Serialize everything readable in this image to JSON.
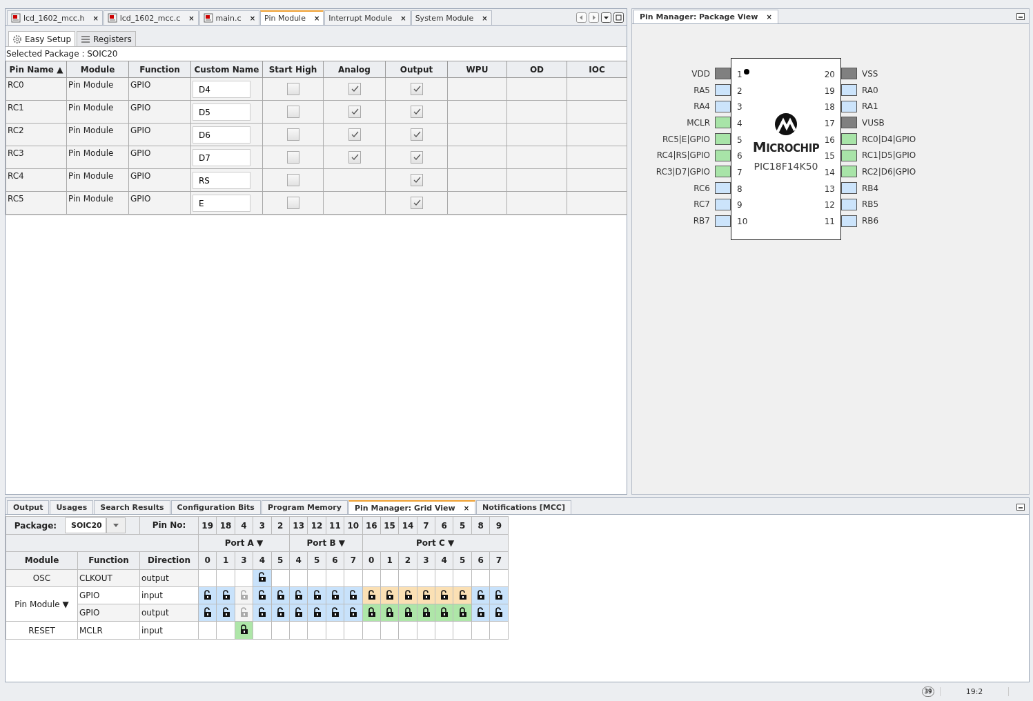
{
  "editor_tabs": [
    {
      "label": "lcd_1602_mcc.h",
      "kind": "file",
      "selected": false,
      "close": "×"
    },
    {
      "label": "lcd_1602_mcc.c",
      "kind": "file",
      "selected": false,
      "close": "×"
    },
    {
      "label": "main.c",
      "kind": "file",
      "selected": false,
      "close": "×"
    },
    {
      "label": "Pin Module",
      "kind": "plain",
      "selected": true,
      "close": "×"
    },
    {
      "label": "Interrupt Module",
      "kind": "plain",
      "selected": false,
      "close": "×"
    },
    {
      "label": "System Module",
      "kind": "plain",
      "selected": false,
      "close": "×"
    }
  ],
  "sub_tabs": [
    {
      "label": "Easy Setup",
      "kind": "gear",
      "selected": true
    },
    {
      "label": "Registers",
      "kind": "list",
      "selected": false
    }
  ],
  "selected_package": "Selected Package : SOIC20",
  "pin_table": {
    "columns": [
      "Pin Name ▲",
      "Module",
      "Function",
      "Custom Name",
      "Start High",
      "Analog",
      "Output",
      "WPU",
      "OD",
      "IOC"
    ],
    "rows": [
      {
        "pin": "RC0",
        "module": "Pin Module",
        "function": "GPIO",
        "custom_name": "D4",
        "start_high": false,
        "analog": true,
        "output": true
      },
      {
        "pin": "RC1",
        "module": "Pin Module",
        "function": "GPIO",
        "custom_name": "D5",
        "start_high": false,
        "analog": true,
        "output": true
      },
      {
        "pin": "RC2",
        "module": "Pin Module",
        "function": "GPIO",
        "custom_name": "D6",
        "start_high": false,
        "analog": true,
        "output": true
      },
      {
        "pin": "RC3",
        "module": "Pin Module",
        "function": "GPIO",
        "custom_name": "D7",
        "start_high": false,
        "analog": true,
        "output": true
      },
      {
        "pin": "RC4",
        "module": "Pin Module",
        "function": "GPIO",
        "custom_name": "RS",
        "start_high": false,
        "output": true
      },
      {
        "pin": "RC5",
        "module": "Pin Module",
        "function": "GPIO",
        "custom_name": "E",
        "start_high": false,
        "output": true
      }
    ]
  },
  "package_view": {
    "title": "Pin Manager: Package View",
    "close": "×",
    "brand": "MICROCHIP",
    "device": "PIC18F14K50",
    "left_pins": [
      {
        "number": "1",
        "label": "VDD",
        "color": "#808080"
      },
      {
        "number": "2",
        "label": "RA5",
        "color": "#cce4fb"
      },
      {
        "number": "3",
        "label": "RA4",
        "color": "#cce4fb"
      },
      {
        "number": "4",
        "label": "MCLR",
        "color": "#a8e4a8"
      },
      {
        "number": "5",
        "label": "RC5|E|GPIO",
        "color": "#a8e4a8"
      },
      {
        "number": "6",
        "label": "RC4|RS|GPIO",
        "color": "#a8e4a8"
      },
      {
        "number": "7",
        "label": "RC3|D7|GPIO",
        "color": "#a8e4a8"
      },
      {
        "number": "8",
        "label": "RC6",
        "color": "#cce4fb"
      },
      {
        "number": "9",
        "label": "RC7",
        "color": "#cce4fb"
      },
      {
        "number": "10",
        "label": "RB7",
        "color": "#cce4fb"
      }
    ],
    "right_pins": [
      {
        "number": "20",
        "label": "VSS",
        "color": "#808080"
      },
      {
        "number": "19",
        "label": "RA0",
        "color": "#cce4fb"
      },
      {
        "number": "18",
        "label": "RA1",
        "color": "#cce4fb"
      },
      {
        "number": "17",
        "label": "VUSB",
        "color": "#808080"
      },
      {
        "number": "16",
        "label": "RC0|D4|GPIO",
        "color": "#a8e4a8"
      },
      {
        "number": "15",
        "label": "RC1|D5|GPIO",
        "color": "#a8e4a8"
      },
      {
        "number": "14",
        "label": "RC2|D6|GPIO",
        "color": "#a8e4a8"
      },
      {
        "number": "13",
        "label": "RB4",
        "color": "#cce4fb"
      },
      {
        "number": "12",
        "label": "RB5",
        "color": "#cce4fb"
      },
      {
        "number": "11",
        "label": "RB6",
        "color": "#cce4fb"
      }
    ]
  },
  "bottom_tabs": [
    {
      "label": "Output",
      "selected": false
    },
    {
      "label": "Usages",
      "selected": false
    },
    {
      "label": "Search Results",
      "selected": false
    },
    {
      "label": "Configuration Bits",
      "selected": false
    },
    {
      "label": "Program Memory",
      "selected": false
    },
    {
      "label": "Pin Manager: Grid View",
      "selected": true,
      "close": "×"
    },
    {
      "label": "Notifications [MCC]",
      "selected": false
    }
  ],
  "grid_view": {
    "package_label": "Package:",
    "package_value": "SOIC20",
    "pin_no_label": "Pin No:",
    "pin_numbers": [
      "19",
      "18",
      "4",
      "3",
      "2",
      "13",
      "12",
      "11",
      "10",
      "16",
      "15",
      "14",
      "7",
      "6",
      "5",
      "8",
      "9"
    ],
    "ports": [
      {
        "label": "Port A ▼",
        "bits": [
          "0",
          "1",
          "3",
          "4",
          "5"
        ]
      },
      {
        "label": "Port B ▼",
        "bits": [
          "4",
          "5",
          "6",
          "7"
        ]
      },
      {
        "label": "Port C ▼",
        "bits": [
          "0",
          "1",
          "2",
          "3",
          "4",
          "5",
          "6",
          "7"
        ]
      }
    ],
    "headers": [
      "Module",
      "Function",
      "Direction"
    ],
    "groups": [
      {
        "module": "OSC",
        "rows": [
          {
            "function": "CLKOUT",
            "direction": "output",
            "cells": [
              {
                "kind": "none"
              },
              {
                "kind": "none"
              },
              {
                "kind": "none"
              },
              {
                "kind": "open",
                "color": "#c8e2fb"
              },
              {
                "kind": "none"
              },
              {
                "kind": "none"
              },
              {
                "kind": "none"
              },
              {
                "kind": "none"
              },
              {
                "kind": "none"
              },
              {
                "kind": "none"
              },
              {
                "kind": "none"
              },
              {
                "kind": "none"
              },
              {
                "kind": "none"
              },
              {
                "kind": "none"
              },
              {
                "kind": "none"
              },
              {
                "kind": "none"
              },
              {
                "kind": "none"
              }
            ]
          }
        ]
      },
      {
        "module": "Pin Module ▼",
        "rows": [
          {
            "function": "GPIO",
            "direction": "input",
            "cells": [
              {
                "kind": "open",
                "color": "#c8e2fb"
              },
              {
                "kind": "open",
                "color": "#c8e2fb"
              },
              {
                "kind": "unavailable"
              },
              {
                "kind": "open",
                "color": "#c8e2fb"
              },
              {
                "kind": "open",
                "color": "#c8e2fb"
              },
              {
                "kind": "open",
                "color": "#c8e2fb"
              },
              {
                "kind": "open",
                "color": "#c8e2fb"
              },
              {
                "kind": "open",
                "color": "#c8e2fb"
              },
              {
                "kind": "open",
                "color": "#c8e2fb"
              },
              {
                "kind": "open",
                "color": "#fbe0b4"
              },
              {
                "kind": "open",
                "color": "#fbe0b4"
              },
              {
                "kind": "open",
                "color": "#fbe0b4"
              },
              {
                "kind": "open",
                "color": "#fbe0b4"
              },
              {
                "kind": "open",
                "color": "#fbe0b4"
              },
              {
                "kind": "open",
                "color": "#fbe0b4"
              },
              {
                "kind": "open",
                "color": "#c8e2fb"
              },
              {
                "kind": "open",
                "color": "#c8e2fb"
              }
            ]
          },
          {
            "function": "GPIO",
            "direction": "output",
            "cells": [
              {
                "kind": "open",
                "color": "#c8e2fb"
              },
              {
                "kind": "open",
                "color": "#c8e2fb"
              },
              {
                "kind": "unavailable"
              },
              {
                "kind": "open",
                "color": "#c8e2fb"
              },
              {
                "kind": "open",
                "color": "#c8e2fb"
              },
              {
                "kind": "open",
                "color": "#c8e2fb"
              },
              {
                "kind": "open",
                "color": "#c8e2fb"
              },
              {
                "kind": "open",
                "color": "#c8e2fb"
              },
              {
                "kind": "open",
                "color": "#c8e2fb"
              },
              {
                "kind": "locked",
                "color": "#aee6a8"
              },
              {
                "kind": "locked",
                "color": "#aee6a8"
              },
              {
                "kind": "locked",
                "color": "#aee6a8"
              },
              {
                "kind": "locked",
                "color": "#aee6a8"
              },
              {
                "kind": "locked",
                "color": "#aee6a8"
              },
              {
                "kind": "locked",
                "color": "#aee6a8"
              },
              {
                "kind": "open",
                "color": "#c8e2fb"
              },
              {
                "kind": "open",
                "color": "#c8e2fb"
              }
            ]
          }
        ]
      },
      {
        "module": "RESET",
        "rows": [
          {
            "function": "MCLR",
            "direction": "input",
            "cells": [
              {
                "kind": "none"
              },
              {
                "kind": "none"
              },
              {
                "kind": "locked",
                "color": "#aee6a8"
              },
              {
                "kind": "none"
              },
              {
                "kind": "none"
              },
              {
                "kind": "none"
              },
              {
                "kind": "none"
              },
              {
                "kind": "none"
              },
              {
                "kind": "none"
              },
              {
                "kind": "none"
              },
              {
                "kind": "none"
              },
              {
                "kind": "none"
              },
              {
                "kind": "none"
              },
              {
                "kind": "none"
              },
              {
                "kind": "none"
              },
              {
                "kind": "none"
              },
              {
                "kind": "none"
              }
            ]
          }
        ]
      }
    ]
  },
  "status_bar": {
    "notifications": "39",
    "position": "19:2"
  }
}
